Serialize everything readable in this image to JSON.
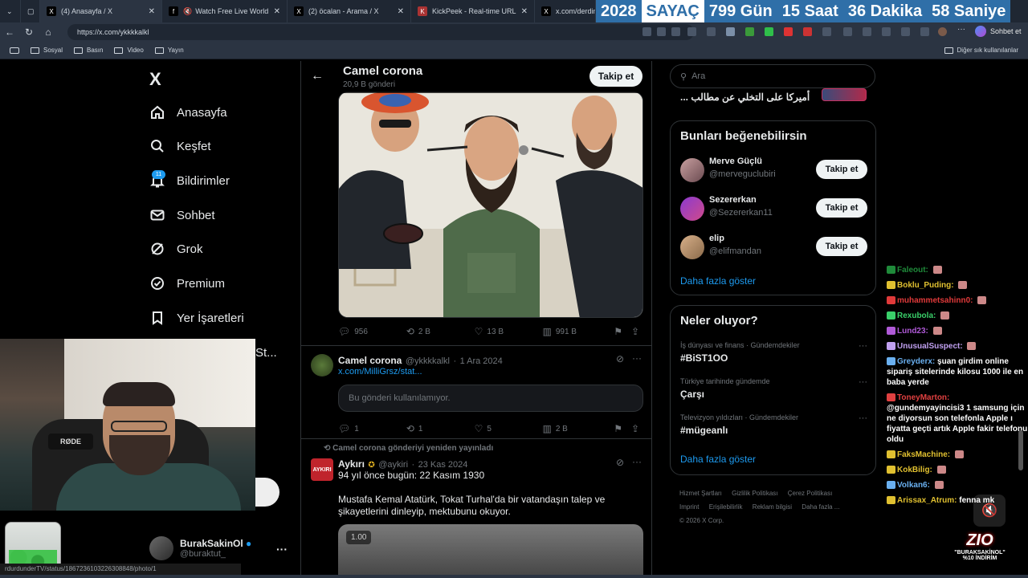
{
  "browser": {
    "tabs": [
      {
        "icon": "X",
        "title": "(4) Anasayfa / X"
      },
      {
        "icon": "f",
        "title": "Watch Free Live World TV | C"
      },
      {
        "icon": "X",
        "title": "(2) öcalan - Arama / X"
      },
      {
        "icon": "K",
        "title": "KickPeek - Real-time URL Crawler"
      },
      {
        "icon": "X",
        "title": "x.com/derdin"
      }
    ],
    "counter": {
      "year": "2028",
      "label": "SAYAÇ",
      "days": "799 Gün",
      "hours": "15 Saat",
      "minutes": "36 Dakika",
      "seconds": "58 Saniye"
    },
    "url": "https://x.com/ykkkkalkl",
    "chat_button": "Sohbet et",
    "bookmarks": [
      "Sosyal",
      "Basın",
      "Video",
      "Yayın"
    ],
    "other_bookmarks": "Diğer sık kullanılanlar",
    "status_url": "rdurdunderTV/status/1867236103226308848/photo/1"
  },
  "left_nav": {
    "logo": "X",
    "items": [
      {
        "label": "Anasayfa",
        "icon": "home-icon"
      },
      {
        "label": "Keşfet",
        "icon": "search-icon"
      },
      {
        "label": "Bildirimler",
        "icon": "bell-icon"
      },
      {
        "label": "Sohbet",
        "icon": "mail-icon"
      },
      {
        "label": "Grok",
        "icon": "grok-icon"
      },
      {
        "label": "Premium",
        "icon": "premium-icon"
      },
      {
        "label": "Yer İşaretleri",
        "icon": "bookmark-icon"
      }
    ],
    "notification_badge": "11",
    "partial_item": "St...",
    "account": {
      "name": "BurakSakinOl",
      "handle": "@buraktut_",
      "more": "···"
    }
  },
  "profile_header": {
    "back": "←",
    "title": "Camel corona",
    "subtitle": "20,9 B gönderi",
    "follow": "Takip et"
  },
  "posts": [
    {
      "stats": {
        "replies": "956",
        "reposts": "2 B",
        "likes": "13 B",
        "views": "991 B"
      }
    },
    {
      "name": "Camel corona",
      "handle": "@ykkkkalkl",
      "date": "1 Ara 2024",
      "link": "x.com/MilliGrsz/stat...",
      "unavailable": "Bu gönderi kullanılamıyor.",
      "stats": {
        "replies": "1",
        "reposts": "1",
        "likes": "5",
        "views": "2 B"
      }
    },
    {
      "repost_label": "Camel corona gönderiyi yeniden yayınladı",
      "avatar_text": "AYKIRI",
      "name": "Aykırı",
      "handle": "@aykiri",
      "date": "23 Kas 2024",
      "text1": "94 yıl önce bugün: 22 Kasım 1930",
      "text2": "Mustafa Kemal Atatürk, Tokat Turhal'da bir vatandaşın talep ve şikayetlerini dinleyip, mektubunu okuyor.",
      "video_time": "1.00"
    }
  ],
  "right": {
    "search_placeholder": "Ara",
    "top_trend": "أميركا على التخلي عن مطالب ...",
    "who_to_follow": {
      "title": "Bunları beğenebilirsin",
      "users": [
        {
          "name": "Merve Güçlü",
          "handle": "@merveguclubiri",
          "button": "Takip et"
        },
        {
          "name": "Sezererkan",
          "handle": "@Sezererkan11",
          "button": "Takip et"
        },
        {
          "name": "elip",
          "handle": "@elifmandan",
          "button": "Takip et"
        }
      ],
      "show_more": "Daha fazla göster"
    },
    "whats_happening": {
      "title": "Neler oluyor?",
      "trends": [
        {
          "context": "İş dünyası ve finans · Gündemdekiler",
          "topic": "#BiST1OO"
        },
        {
          "context": "Türkiye tarihinde gündemde",
          "topic": "Çarşı"
        },
        {
          "context": "Televizyon yıldızları · Gündemdekiler",
          "topic": "#mügeanlı"
        }
      ],
      "show_more": "Daha fazla göster"
    },
    "footer": [
      "Hizmet Şartları",
      "Gizlilik Politikası",
      "Çerez Politikası",
      "Imprint",
      "Erişilebilirlik",
      "Reklam bilgisi",
      "Daha fazla ...",
      "© 2026 X Corp."
    ]
  },
  "chat": [
    {
      "user": "Faleout:",
      "text": "",
      "color": "#1f8a3a"
    },
    {
      "user": "Boklu_Puding:",
      "text": "",
      "color": "#e0c030"
    },
    {
      "user": "muhammetsahinn0:",
      "text": "",
      "color": "#e03a3a"
    },
    {
      "user": "Rexubola:",
      "text": "",
      "color": "#3ad06a"
    },
    {
      "user": "Lund23:",
      "text": "",
      "color": "#b05ad8"
    },
    {
      "user": "UnusualSuspect:",
      "text": "",
      "color": "#c0a0f0"
    },
    {
      "user": "Greyderx:",
      "text": "şuan girdim online sipariş sitelerinde kilosu 1000 ile en baba yerde",
      "color": "#6ab0f0"
    },
    {
      "user": "ToneyMarton:",
      "text": "@gundemyayincisi3 1 samsung için ne diyorsun son telefonla Apple ı fiyatta geçti artık Apple fakir telefonu oldu",
      "color": "#e04040"
    },
    {
      "user": "FaksMachine:",
      "text": "",
      "color": "#e0c030"
    },
    {
      "user": "KokBilig:",
      "text": "",
      "color": "#e0c030"
    },
    {
      "user": "Volkan6:",
      "text": "",
      "color": "#6ab0f0"
    },
    {
      "user": "Arissax_Atrum:",
      "text": "fenna mk",
      "color": "#e0c030"
    }
  ],
  "promo": {
    "logo": "ZIO",
    "line1": "\"BURAKSAKİNOL\"",
    "line2": "%10 İNDİRİM"
  },
  "webcam": {
    "mic_brand": "RØDE"
  }
}
